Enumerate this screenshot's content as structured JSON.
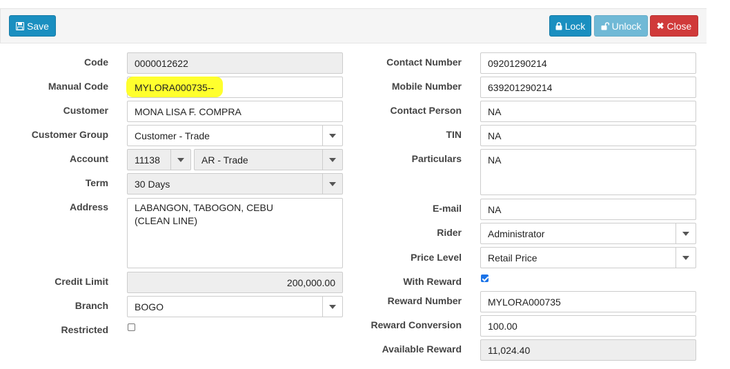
{
  "toolbar": {
    "save_label": "Save",
    "lock_label": "Lock",
    "unlock_label": "Unlock",
    "close_label": "Close"
  },
  "left": {
    "code": {
      "label": "Code",
      "value": "0000012622"
    },
    "manual_code": {
      "label": "Manual Code",
      "value": "MYLORA000735--"
    },
    "customer": {
      "label": "Customer",
      "value": "MONA LISA F. COMPRA"
    },
    "customer_group": {
      "label": "Customer Group",
      "value": "Customer - Trade"
    },
    "account": {
      "label": "Account",
      "code": "11138",
      "name": "AR - Trade"
    },
    "term": {
      "label": "Term",
      "value": "30 Days"
    },
    "address": {
      "label": "Address",
      "value": "LABANGON, TABOGON, CEBU\n(CLEAN LINE)"
    },
    "credit_limit": {
      "label": "Credit Limit",
      "value": "200,000.00"
    },
    "branch": {
      "label": "Branch",
      "value": "BOGO"
    },
    "restricted": {
      "label": "Restricted",
      "checked": false
    }
  },
  "right": {
    "contact_number": {
      "label": "Contact Number",
      "value": "09201290214"
    },
    "mobile_number": {
      "label": "Mobile Number",
      "value": "639201290214"
    },
    "contact_person": {
      "label": "Contact Person",
      "value": "NA"
    },
    "tin": {
      "label": "TIN",
      "value": "NA"
    },
    "particulars": {
      "label": "Particulars",
      "value": "NA"
    },
    "email": {
      "label": "E-mail",
      "value": "NA"
    },
    "rider": {
      "label": "Rider",
      "value": "Administrator"
    },
    "price_level": {
      "label": "Price Level",
      "value": "Retail Price"
    },
    "with_reward": {
      "label": "With Reward",
      "checked": true
    },
    "reward_number": {
      "label": "Reward Number",
      "value": "MYLORA000735"
    },
    "reward_conversion": {
      "label": "Reward Conversion",
      "value": "100.00"
    },
    "available_reward": {
      "label": "Available Reward",
      "value": "11,024.40"
    }
  },
  "colors": {
    "primary": "#1a8fc0",
    "unlock": "#70b9d6",
    "danger": "#d03a3a",
    "highlight": "#ffff22"
  },
  "icons": [
    "save-icon",
    "lock-icon",
    "unlock-icon",
    "close-icon",
    "chevron-down-icon"
  ]
}
